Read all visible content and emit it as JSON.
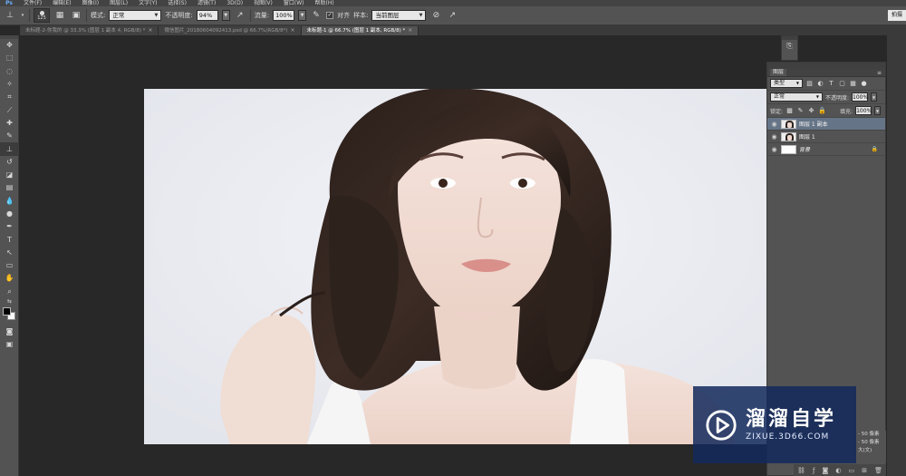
{
  "app": {
    "logo": "Ps",
    "menus": [
      "文件(F)",
      "编辑(E)",
      "图像(I)",
      "图层(L)",
      "文字(Y)",
      "选择(S)",
      "滤镜(T)",
      "3D(D)",
      "视图(V)",
      "窗口(W)",
      "帮助(H)"
    ]
  },
  "options": {
    "brush_size": "125",
    "mode_label": "模式:",
    "mode_value": "正常",
    "opacity_label": "不透明度:",
    "opacity_value": "94%",
    "flow_label": "流量:",
    "flow_value": "100%",
    "align_label": "对齐",
    "sample_label": "样本:",
    "sample_value": "当前图层",
    "right_field": "拍摄"
  },
  "tabs": [
    {
      "label": "未标题-2-你我的 @ 33.3% (图层 1 副本 4, RGB/8) *",
      "active": false
    },
    {
      "label": "微信图片_20180604092413.psd @ 66.7%(RGB/8*)",
      "active": false
    },
    {
      "label": "未标题-1 @ 66.7% (图层 1 副本, RGB/8) *",
      "active": true
    }
  ],
  "layers_panel": {
    "tab_title": "图层",
    "filter_value": "类型",
    "blend_mode": "正常",
    "opacity_label": "不透明度:",
    "opacity_value": "100%",
    "lock_label": "锁定:",
    "fill_label": "填充:",
    "fill_value": "100%",
    "layers": [
      {
        "name": "图层 1 副本",
        "selected": true,
        "thumb": "portrait",
        "italic": false,
        "locked": false
      },
      {
        "name": "图层 1",
        "selected": false,
        "thumb": "portrait",
        "italic": false,
        "locked": false
      },
      {
        "name": "背景",
        "selected": false,
        "thumb": "white",
        "italic": true,
        "locked": true
      }
    ]
  },
  "presets": [
    "- 50 像素",
    "- 50 像素",
    "大(文)"
  ],
  "watermark": {
    "title": "溜溜自学",
    "url": "ZIXUE.3D66.COM"
  },
  "colors": {
    "foreground": "#000000",
    "background": "#ffffff",
    "selected_layer": "#667487",
    "watermark_bg": "#142a5c"
  }
}
